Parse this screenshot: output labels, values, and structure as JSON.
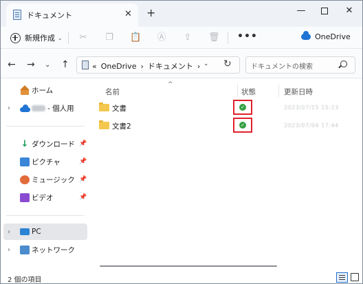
{
  "tab": {
    "title": "ドキュメント",
    "close": "✕",
    "new": "+"
  },
  "window": {
    "minimize": "—",
    "close": "✕"
  },
  "commandbar": {
    "new_label": "新規作成",
    "onedrive_label": "OneDrive",
    "more": "•••"
  },
  "address": {
    "crumbs": [
      "«",
      "OneDrive",
      "›",
      "ドキュメント",
      "›"
    ],
    "dropdown": "⌄",
    "refresh": "↻"
  },
  "search": {
    "placeholder": "ドキュメントの検索"
  },
  "sidebar": {
    "home": "ホーム",
    "onedrive_suffix": "- 個人用",
    "downloads": "ダウンロード",
    "pictures": "ピクチャ",
    "music": "ミュージック",
    "videos": "ビデオ",
    "pc": "PC",
    "network": "ネットワーク"
  },
  "columns": {
    "name": "名前",
    "status": "状態",
    "modified": "更新日時"
  },
  "files": [
    {
      "name": "文書",
      "status": "synced",
      "modified": "2023/07/15 15:23"
    },
    {
      "name": "文書2",
      "status": "synced",
      "modified": "2023/07/04 17:44"
    }
  ],
  "statusbar": {
    "item_count": "2 個の項目"
  },
  "colors": {
    "highlight": "#e0212b",
    "sync_ok": "#35a043",
    "onedrive": "#1f74d4"
  }
}
